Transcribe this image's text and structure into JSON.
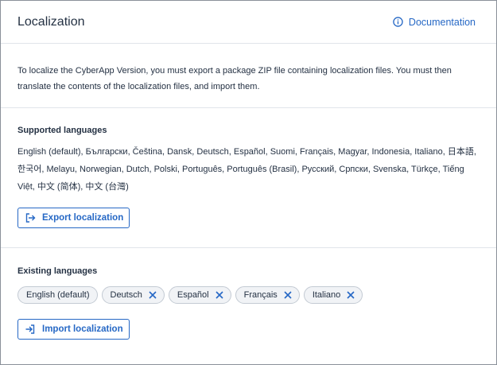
{
  "header": {
    "title": "Localization",
    "documentation_label": "Documentation"
  },
  "intro": {
    "text": "To localize the CyberApp Version, you must export a package ZIP file containing localization files. You must then translate the contents of the localization files, and import them."
  },
  "supported": {
    "title": "Supported languages",
    "languages": "English (default), Български, Čeština, Dansk, Deutsch, Español, Suomi, Français, Magyar, Indonesia, Italiano, 日本語, 한국어, Melayu, Norwegian, Dutch, Polski, Português, Português (Brasil), Русский, Српски, Svenska, Türkçe, Tiếng Việt, 中文 (简体), 中文 (台灣)",
    "export_label": "Export localization"
  },
  "existing": {
    "title": "Existing languages",
    "chips": [
      {
        "label": "English (default)",
        "removable": false
      },
      {
        "label": "Deutsch",
        "removable": true
      },
      {
        "label": "Español",
        "removable": true
      },
      {
        "label": "Français",
        "removable": true
      },
      {
        "label": "Italiano",
        "removable": true
      }
    ],
    "import_label": "Import localization"
  },
  "icons": {
    "documentation": "info-circle-icon",
    "export": "export-icon",
    "import": "import-icon",
    "remove": "close-icon"
  },
  "colors": {
    "accent": "#2668c5",
    "text": "#243143",
    "divider": "#e1e5ea",
    "chip_bg": "#f1f3f6"
  }
}
